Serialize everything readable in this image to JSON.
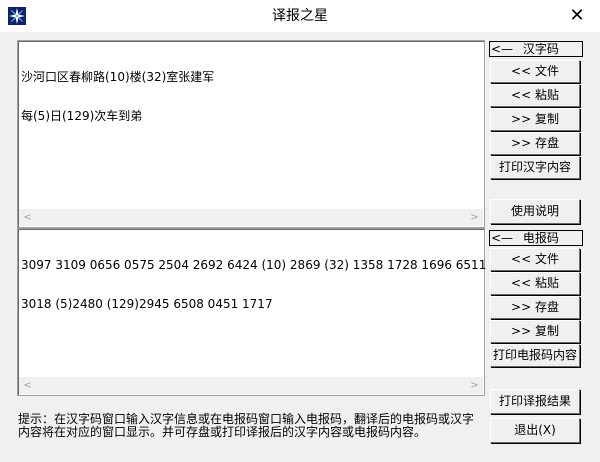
{
  "window": {
    "title": "译报之星"
  },
  "title_bar": {
    "close_glyph": "✕",
    "app_icon": "star-icon"
  },
  "hanzi_pane": {
    "lines": [
      "沙河口区春柳路(10)楼(32)室张建军",
      "每(5)日(129)次车到弟"
    ]
  },
  "telegraph_pane": {
    "lines": [
      "3097 3109 0656 0575 2504 2692 6424 (10) 2869 (32) 1358 1728 1696 6511",
      "3018 (5)2480 (129)2945 6508 0451 1717"
    ]
  },
  "scrollbar": {
    "left_arrow": "<",
    "right_arrow": ">"
  },
  "hanzi_caption": {
    "arrow": "<—",
    "label": "汉字码"
  },
  "telegraph_caption": {
    "arrow": "<—",
    "label": "电报码"
  },
  "hanzi_buttons": {
    "file": "<< 文件",
    "paste": "<< 粘贴",
    "copy": ">> 复制",
    "save": ">> 存盘",
    "print": "打印汉字内容"
  },
  "help_button": "使用说明",
  "telegraph_buttons": {
    "file": "<<  文件",
    "paste": "<< 粘贴",
    "save": ">> 存盘",
    "copy": ">> 复制",
    "print": "打印电报码内容"
  },
  "print_result_button": "打印译报结果",
  "exit_button": "退出(X)",
  "hint": {
    "line1": "提示：在汉字码窗口输入汉字信息或在电报码窗口输入电报码，翻译后的电报码或汉字",
    "line2": "内容将在对应的窗口显示。并可存盘或打印译报后的汉字内容或电报码内容。"
  }
}
